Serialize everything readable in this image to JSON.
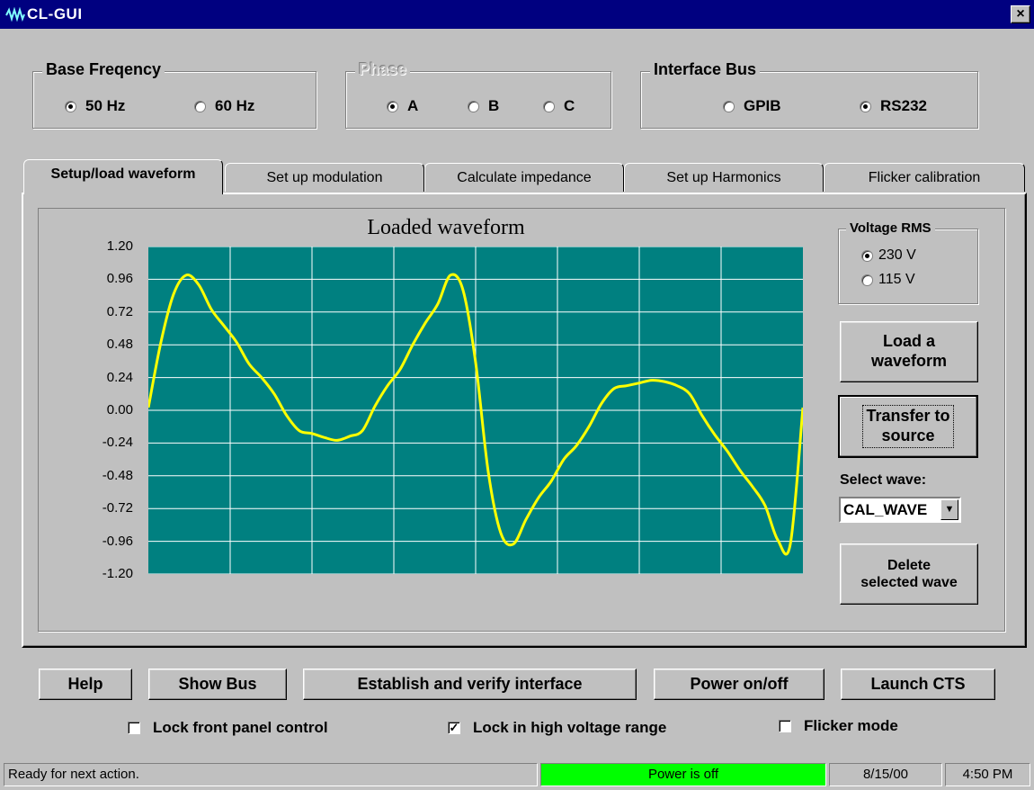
{
  "window": {
    "title": "CL-GUI",
    "close_label": "×",
    "icon": "waveform-app-icon"
  },
  "base_frequency": {
    "legend": "Base Freqency",
    "options": [
      {
        "label": "50 Hz",
        "checked": true
      },
      {
        "label": "60 Hz",
        "checked": false
      }
    ]
  },
  "phase": {
    "legend": "Phase",
    "disabled_legend": true,
    "options": [
      {
        "label": "A",
        "checked": true
      },
      {
        "label": "B",
        "checked": false
      },
      {
        "label": "C",
        "checked": false
      }
    ]
  },
  "interface_bus": {
    "legend": "Interface Bus",
    "options": [
      {
        "label": "GPIB",
        "checked": false
      },
      {
        "label": "RS232",
        "checked": true
      }
    ]
  },
  "tabs": [
    {
      "label": "Setup/load waveform",
      "active": true
    },
    {
      "label": "Set up modulation",
      "active": false
    },
    {
      "label": "Calculate impedance",
      "active": false
    },
    {
      "label": "Set up Harmonics",
      "active": false
    },
    {
      "label": "Flicker calibration",
      "active": false
    }
  ],
  "chart_data": {
    "type": "line",
    "title": "Loaded waveform",
    "xlabel": "",
    "ylabel": "",
    "ylim": [
      -1.2,
      1.2
    ],
    "y_ticks": [
      "1.20",
      "0.96",
      "0.72",
      "0.48",
      "0.24",
      "0.00",
      "-0.24",
      "-0.48",
      "-0.72",
      "-0.96",
      "-1.20"
    ],
    "x_divisions": 8,
    "grid": true,
    "background_color": "#008080",
    "line_color": "#ffff00",
    "series": [
      {
        "values": [
          0.02,
          0.5,
          0.85,
          0.99,
          0.92,
          0.74,
          0.62,
          0.5,
          0.34,
          0.24,
          0.12,
          -0.04,
          -0.15,
          -0.17,
          -0.2,
          -0.22,
          -0.19,
          -0.15,
          0.03,
          0.18,
          0.3,
          0.48,
          0.64,
          0.78,
          0.99,
          0.88,
          0.35,
          -0.45,
          -0.9,
          -0.98,
          -0.8,
          -0.64,
          -0.52,
          -0.36,
          -0.26,
          -0.12,
          0.05,
          0.16,
          0.18,
          0.2,
          0.22,
          0.21,
          0.18,
          0.12,
          -0.04,
          -0.18,
          -0.3,
          -0.44,
          -0.56,
          -0.7,
          -0.95,
          -0.98,
          0.02
        ]
      }
    ]
  },
  "voltage_rms": {
    "legend": "Voltage RMS",
    "options": [
      {
        "label": "230 V",
        "checked": true
      },
      {
        "label": "115 V",
        "checked": false
      }
    ]
  },
  "side_buttons": {
    "load_line1": "Load a",
    "load_line2": "waveform",
    "transfer_line1": "Transfer to",
    "transfer_line2": "source",
    "delete_line1": "Delete",
    "delete_line2": "selected wave"
  },
  "select_wave": {
    "label": "Select wave:",
    "value": "CAL_WAVE"
  },
  "bottom_buttons": {
    "help": "Help",
    "show_bus": "Show Bus",
    "establish": "Establish and verify interface",
    "power": "Power on/off",
    "launch": "Launch CTS"
  },
  "checkboxes": {
    "lock_front": {
      "label": "Lock front panel control",
      "checked": false
    },
    "lock_high": {
      "label": "Lock in high voltage range",
      "checked": true
    },
    "flicker": {
      "label": "Flicker mode",
      "checked": false
    }
  },
  "status": {
    "message": "Ready for next action.",
    "power": "Power is off",
    "power_color": "#00ff00",
    "date": "8/15/00",
    "time": "4:50 PM"
  }
}
